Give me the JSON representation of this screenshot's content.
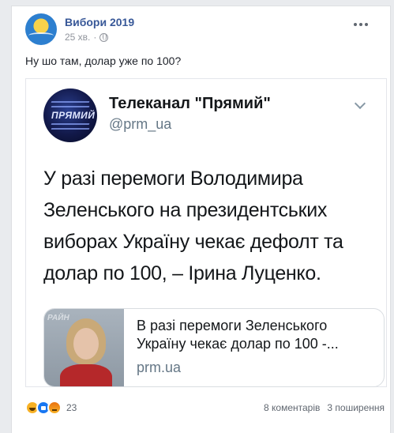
{
  "post": {
    "page_name": "Вибори 2019",
    "time": "25 хв.",
    "separator": "·",
    "text": "Ну шо там, долар уже по 100?"
  },
  "tweet": {
    "name": "Телеканал \"Прямий\"",
    "handle": "@prm_ua",
    "avatar_label": "ПРЯМИЙ",
    "text": "У разі перемоги Володимира Зеленського на президентських виборах Україну чекає дефолт та долар по 100, – Ірина Луценко.",
    "link_card": {
      "title": "В разі перемоги Зеленського Україну чекає долар по 100 -...",
      "domain": "prm.ua",
      "thumb_label": "РАЙН"
    }
  },
  "footer": {
    "reactions": [
      "haha-icon",
      "like-icon",
      "angry-icon"
    ],
    "reaction_count": "23",
    "comments": "8 коментарів",
    "shares": "3 поширення"
  },
  "colors": {
    "page_name": "#385898",
    "meta": "#90949c",
    "like": "#1877f2",
    "haha": "#f7b125"
  }
}
